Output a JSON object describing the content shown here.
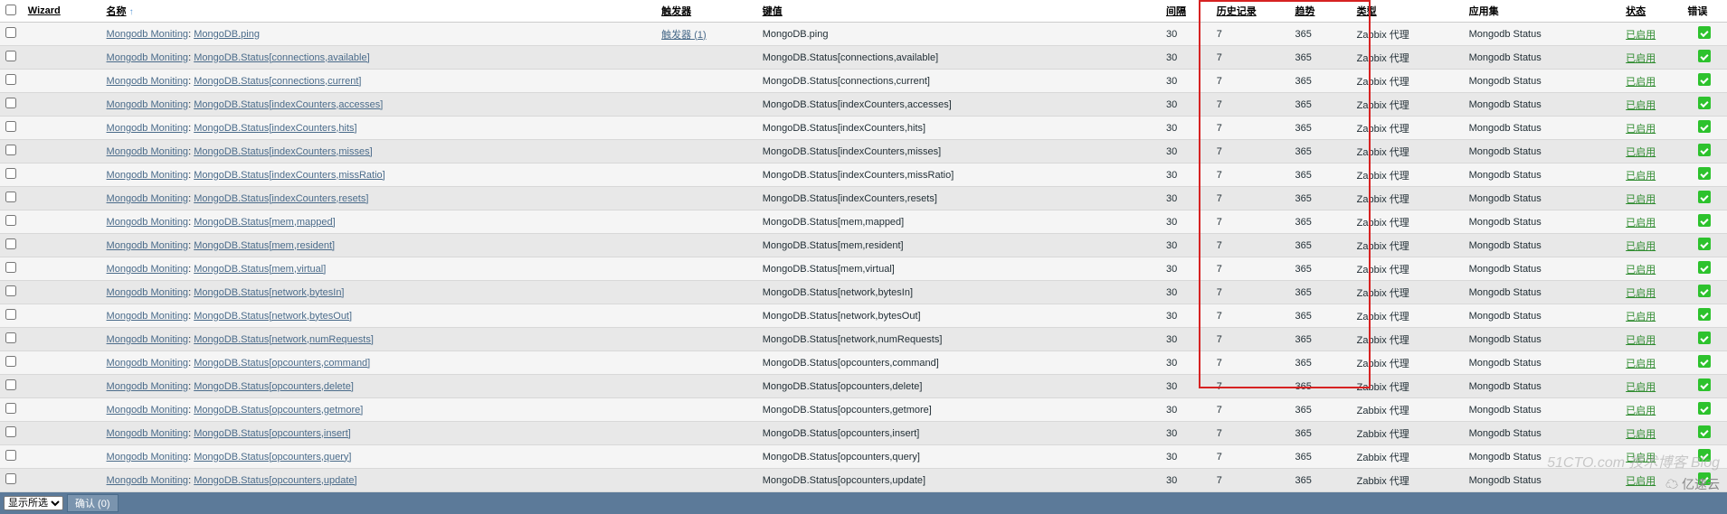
{
  "headers": {
    "wizard": "Wizard",
    "name": "名称",
    "trigger": "触发器",
    "key": "键值",
    "interval": "间隔",
    "history": "历史记录",
    "trend": "趋势",
    "type": "类型",
    "app": "应用集",
    "status": "状态",
    "error": "错误"
  },
  "template_name": "Mongodb Moniting",
  "trigger_link": "触发器 (1)",
  "status_label": "已启用",
  "app_label": "Mongodb Status",
  "agent_type": "Zabbix 代理",
  "interval_val": "30",
  "history_val": "7",
  "trend_val": "365",
  "rows": [
    {
      "name": "MongoDB.ping",
      "key": "MongoDB.ping",
      "has_trigger": true
    },
    {
      "name": "MongoDB.Status[connections,available]",
      "key": "MongoDB.Status[connections,available]",
      "has_trigger": false
    },
    {
      "name": "MongoDB.Status[connections,current]",
      "key": "MongoDB.Status[connections,current]",
      "has_trigger": false
    },
    {
      "name": "MongoDB.Status[indexCounters,accesses]",
      "key": "MongoDB.Status[indexCounters,accesses]",
      "has_trigger": false
    },
    {
      "name": "MongoDB.Status[indexCounters,hits]",
      "key": "MongoDB.Status[indexCounters,hits]",
      "has_trigger": false
    },
    {
      "name": "MongoDB.Status[indexCounters,misses]",
      "key": "MongoDB.Status[indexCounters,misses]",
      "has_trigger": false
    },
    {
      "name": "MongoDB.Status[indexCounters,missRatio]",
      "key": "MongoDB.Status[indexCounters,missRatio]",
      "has_trigger": false
    },
    {
      "name": "MongoDB.Status[indexCounters,resets]",
      "key": "MongoDB.Status[indexCounters,resets]",
      "has_trigger": false
    },
    {
      "name": "MongoDB.Status[mem,mapped]",
      "key": "MongoDB.Status[mem,mapped]",
      "has_trigger": false
    },
    {
      "name": "MongoDB.Status[mem,resident]",
      "key": "MongoDB.Status[mem,resident]",
      "has_trigger": false
    },
    {
      "name": "MongoDB.Status[mem,virtual]",
      "key": "MongoDB.Status[mem,virtual]",
      "has_trigger": false
    },
    {
      "name": "MongoDB.Status[network,bytesIn]",
      "key": "MongoDB.Status[network,bytesIn]",
      "has_trigger": false
    },
    {
      "name": "MongoDB.Status[network,bytesOut]",
      "key": "MongoDB.Status[network,bytesOut]",
      "has_trigger": false
    },
    {
      "name": "MongoDB.Status[network,numRequests]",
      "key": "MongoDB.Status[network,numRequests]",
      "has_trigger": false
    },
    {
      "name": "MongoDB.Status[opcounters,command]",
      "key": "MongoDB.Status[opcounters,command]",
      "has_trigger": false
    },
    {
      "name": "MongoDB.Status[opcounters,delete]",
      "key": "MongoDB.Status[opcounters,delete]",
      "has_trigger": false
    },
    {
      "name": "MongoDB.Status[opcounters,getmore]",
      "key": "MongoDB.Status[opcounters,getmore]",
      "has_trigger": false
    },
    {
      "name": "MongoDB.Status[opcounters,insert]",
      "key": "MongoDB.Status[opcounters,insert]",
      "has_trigger": false
    },
    {
      "name": "MongoDB.Status[opcounters,query]",
      "key": "MongoDB.Status[opcounters,query]",
      "has_trigger": false
    },
    {
      "name": "MongoDB.Status[opcounters,update]",
      "key": "MongoDB.Status[opcounters,update]",
      "has_trigger": false
    }
  ],
  "footer": {
    "select_option": "显示所选",
    "go_button": "确认 (0)"
  },
  "watermark": "51CTO.com 技术博客 Blog",
  "cloud": "亿速云"
}
